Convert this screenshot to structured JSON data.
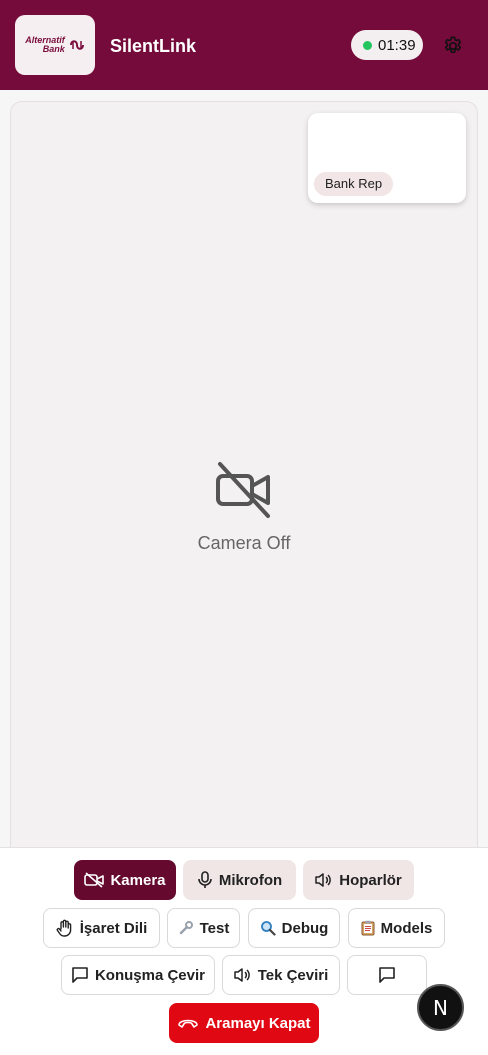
{
  "header": {
    "logo_line1": "Alternatif",
    "logo_line2": "Bank",
    "title": "SilentLink",
    "timer": "01:39",
    "status_color": "#22c55e",
    "brand_color": "#750b3a"
  },
  "video": {
    "rep_label": "Bank Rep",
    "camera_off_label": "Camera Off"
  },
  "controls": {
    "camera": "Kamera",
    "microphone": "Mikrofon",
    "speaker": "Hoparlör",
    "sign_language": "İşaret Dili",
    "test": "Test",
    "debug": "Debug",
    "models": "Models",
    "speech_translate": "Konuşma Çevir",
    "single_translate": "Tek Çeviri",
    "end_call": "Aramayı Kapat"
  },
  "overlay": {
    "n_badge": "N"
  }
}
